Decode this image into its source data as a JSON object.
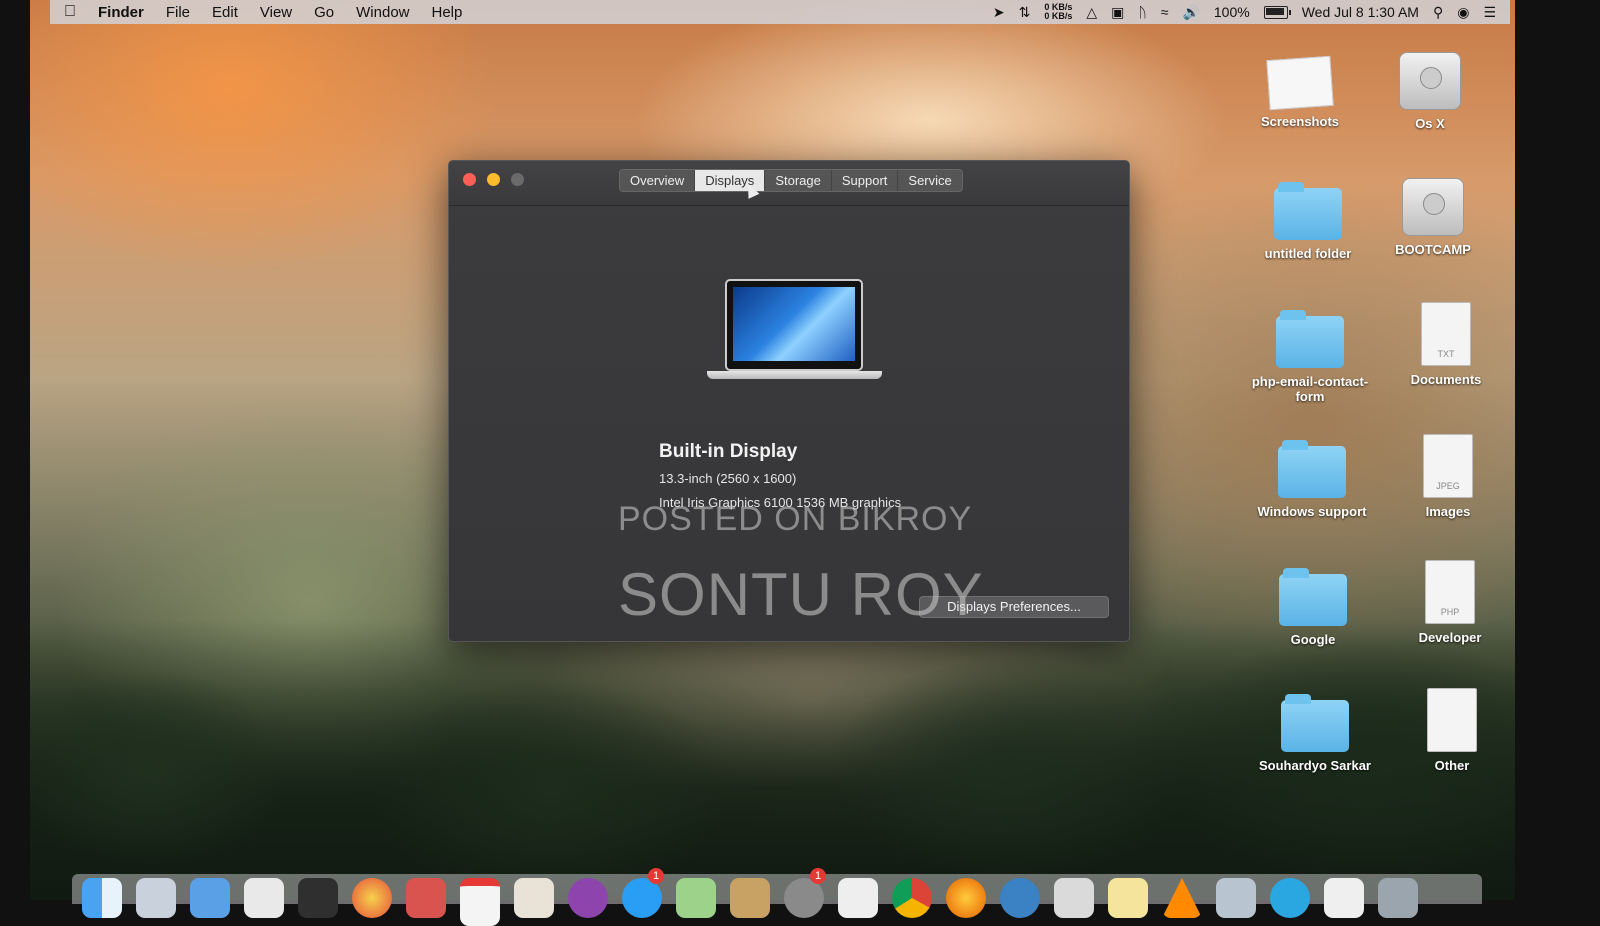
{
  "menubar": {
    "apple_icon": "apple-logo-icon",
    "app_name": "Finder",
    "menus": [
      "File",
      "Edit",
      "View",
      "Go",
      "Window",
      "Help"
    ],
    "network_up": "0 KB/s",
    "network_down": "0 KB/s",
    "battery_percent": "100%",
    "battery_level": 1.0,
    "datetime": "Wed Jul 8  1:30 AM"
  },
  "window": {
    "tabs": [
      "Overview",
      "Displays",
      "Storage",
      "Support",
      "Service"
    ],
    "active_tab": "Displays",
    "display_name": "Built-in Display",
    "display_size": "13.3-inch (2560 x 1600)",
    "display_gpu": "Intel Iris Graphics 6100 1536 MB graphics",
    "prefs_button": "Displays Preferences..."
  },
  "watermark": {
    "line1": "POSTED ON BIKROY",
    "line2": "SONTU ROY"
  },
  "desktop": {
    "icons": [
      {
        "label": "Screenshots",
        "kind": "image"
      },
      {
        "label": "Os X",
        "kind": "disk"
      },
      {
        "label": "untitled folder",
        "kind": "folder"
      },
      {
        "label": "BOOTCAMP",
        "kind": "disk"
      },
      {
        "label": "php-email-contact-form",
        "kind": "folder"
      },
      {
        "label": "Documents",
        "kind": "doc",
        "ext": "TXT"
      },
      {
        "label": "Windows support",
        "kind": "folder"
      },
      {
        "label": "Images",
        "kind": "doc",
        "ext": "JPEG"
      },
      {
        "label": "Google",
        "kind": "folder"
      },
      {
        "label": "Developer",
        "kind": "doc",
        "ext": "PHP"
      },
      {
        "label": "Souhardyo Sarkar",
        "kind": "folder"
      },
      {
        "label": "Other",
        "kind": "doc",
        "ext": ""
      }
    ]
  },
  "dock": {
    "badges": [
      "1",
      "1"
    ]
  },
  "colors": {
    "close": "#fc5f57",
    "minimize": "#fdbb2e",
    "folder": "#5ab3e6"
  }
}
